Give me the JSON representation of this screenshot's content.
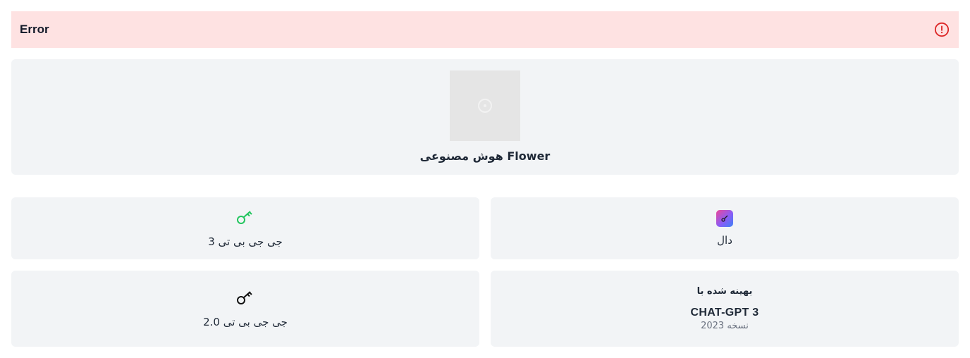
{
  "error": {
    "title": "Error",
    "icon": "alert-circle-icon",
    "color": "#dc2626"
  },
  "hero": {
    "image_icon": "image-placeholder-icon",
    "title": "Flower هوش مصنوعی"
  },
  "cards": {
    "dal": {
      "label": "دال",
      "icon": "dal-key-icon"
    },
    "gpt3": {
      "label": "جی جی بی تی 3",
      "icon": "key-icon",
      "icon_color": "#22c55e"
    },
    "optimized": {
      "label": "بهینه شده با",
      "model": "CHAT-GPT 3",
      "version": "نسخه 2023"
    },
    "gpt2": {
      "label": "جی جی بی تی 2.0",
      "icon": "key-icon",
      "icon_color": "#111111"
    }
  }
}
